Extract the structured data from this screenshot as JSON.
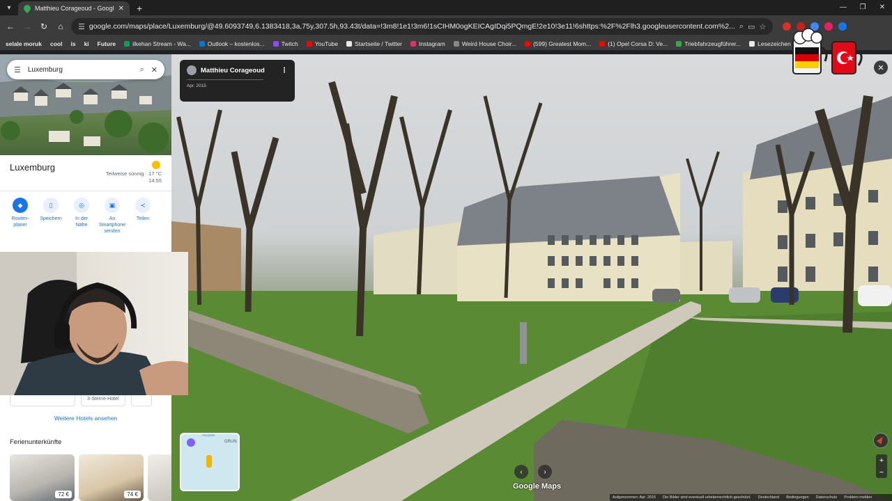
{
  "browser": {
    "tab_title": "Matthieu Corageoud - Google",
    "url": "google.com/maps/place/Luxemburg/@49.6093749,6.1383418,3a,75y,307.5h,93.43t/data=!3m8!1e1!3m6!1sCIHM0ogKEICAgIDqi5PQmgE!2e10!3e11!6shttps:%2F%2Flh3.googleusercontent.com%2...",
    "bookmarks": [
      {
        "label": "selale moruk",
        "bold": true
      },
      {
        "label": "cool",
        "bold": true
      },
      {
        "label": "is",
        "bold": true
      },
      {
        "label": "ki",
        "bold": true
      },
      {
        "label": "Future",
        "bold": true
      },
      {
        "label": "ilkehan Stream - Wa...",
        "color": "#0f9d58"
      },
      {
        "label": "Outlook – kostenlos...",
        "color": "#0078d4"
      },
      {
        "label": "Twitch",
        "color": "#9146ff"
      },
      {
        "label": "YouTube",
        "color": "#ff0000"
      },
      {
        "label": "Startseite / Twitter",
        "color": "#e8eaed"
      },
      {
        "label": "Instagram",
        "color": "#e1306c"
      },
      {
        "label": "Weird House Choir...",
        "color": "#888888"
      },
      {
        "label": "(599) Greatest Mom...",
        "color": "#ff0000"
      },
      {
        "label": "(1) Opel Corsa D: Ve...",
        "color": "#ff0000"
      },
      {
        "label": "Triebfahrzeugführer...",
        "color": "#34a853"
      },
      {
        "label": "Lesezeichen",
        "color": "#e8eaed"
      }
    ]
  },
  "panel": {
    "search_value": "Luxemburg",
    "place_name": "Luxemburg",
    "weather_desc": "Teilweise sonnig · 17 °C",
    "weather_time": "14:55",
    "actions": [
      {
        "label": "Routen-planer",
        "icon": "directions-icon"
      },
      {
        "label": "Speichern",
        "icon": "bookmark-icon"
      },
      {
        "label": "In der Nähe",
        "icon": "nearby-icon"
      },
      {
        "label": "An Smartphone senden",
        "icon": "phone-icon"
      },
      {
        "label": "Teilen",
        "icon": "share-icon"
      }
    ],
    "hotel_pill": "3-Sterne-Hotel",
    "more_hotels": "Weitere Hotels ansehen",
    "rentals_title": "Ferienunterkünfte",
    "rentals": [
      {
        "price": "72 €"
      },
      {
        "price": "74 €"
      }
    ]
  },
  "streetview": {
    "author": "Matthieu Corageoud",
    "date": "Apr. 2015",
    "brand": "Google Maps",
    "minimap_labels": [
      "Alzette",
      "GRUN"
    ],
    "footer": [
      "Aufgenommen: Apr. 2015",
      "Die Bilder sind eventuell urheberrechtlich geschützt.",
      "Deutschland",
      "Bedingungen",
      "Datenschutz",
      "Problem melden"
    ]
  }
}
